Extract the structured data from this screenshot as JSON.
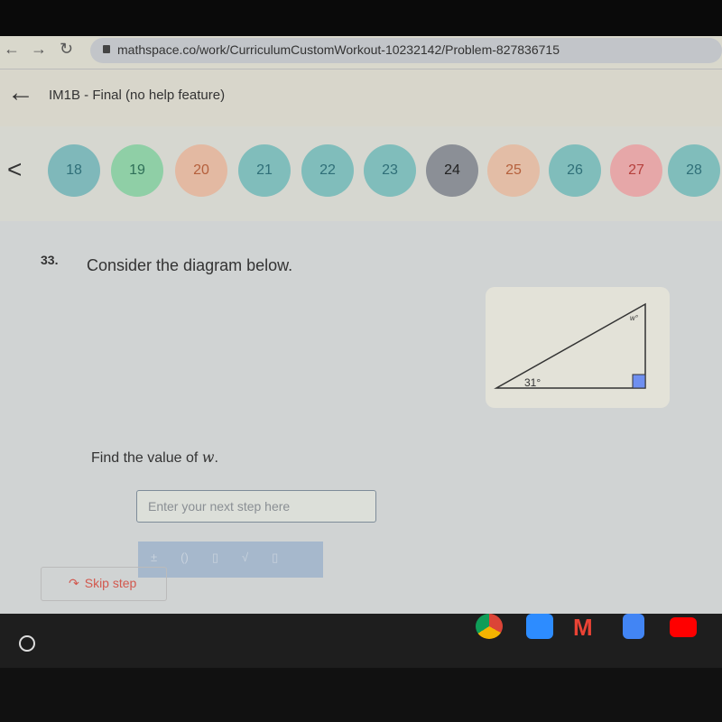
{
  "browser": {
    "url": "mathspace.co/work/CurriculumCustomWorkout-10232142/Problem-827836715"
  },
  "header": {
    "title": "IM1B - Final (no help feature)"
  },
  "tabs": [
    {
      "label": "18",
      "color": "#7fb8ba",
      "text": "#2f6f78"
    },
    {
      "label": "19",
      "color": "#8fcfa6",
      "text": "#2f6f58"
    },
    {
      "label": "20",
      "color": "#e3b9a2",
      "text": "#b5603c"
    },
    {
      "label": "21",
      "color": "#80bdbb",
      "text": "#2f6f78"
    },
    {
      "label": "22",
      "color": "#80bdbb",
      "text": "#2f6f78"
    },
    {
      "label": "23",
      "color": "#80bdbb",
      "text": "#2f6f78"
    },
    {
      "label": "24",
      "color": "#8b8f96",
      "text": "#222"
    },
    {
      "label": "25",
      "color": "#e3bda6",
      "text": "#b5603c"
    },
    {
      "label": "26",
      "color": "#80bdbb",
      "text": "#2f6f78"
    },
    {
      "label": "27",
      "color": "#e6a7a8",
      "text": "#b5403c"
    },
    {
      "label": "28",
      "color": "#80bdbb",
      "text": "#2f6f78"
    }
  ],
  "question": {
    "number": "33.",
    "prompt": "Consider the diagram below.",
    "find_prefix": "Find the value of ",
    "variable": "w",
    "find_suffix": ".",
    "diagram": {
      "angle_bottom": "31°",
      "angle_top": "w°"
    },
    "input_placeholder": "Enter your next step here",
    "keypad": [
      "±",
      "()",
      "▯",
      "√",
      "▯"
    ],
    "skip_label": "Skip step"
  }
}
